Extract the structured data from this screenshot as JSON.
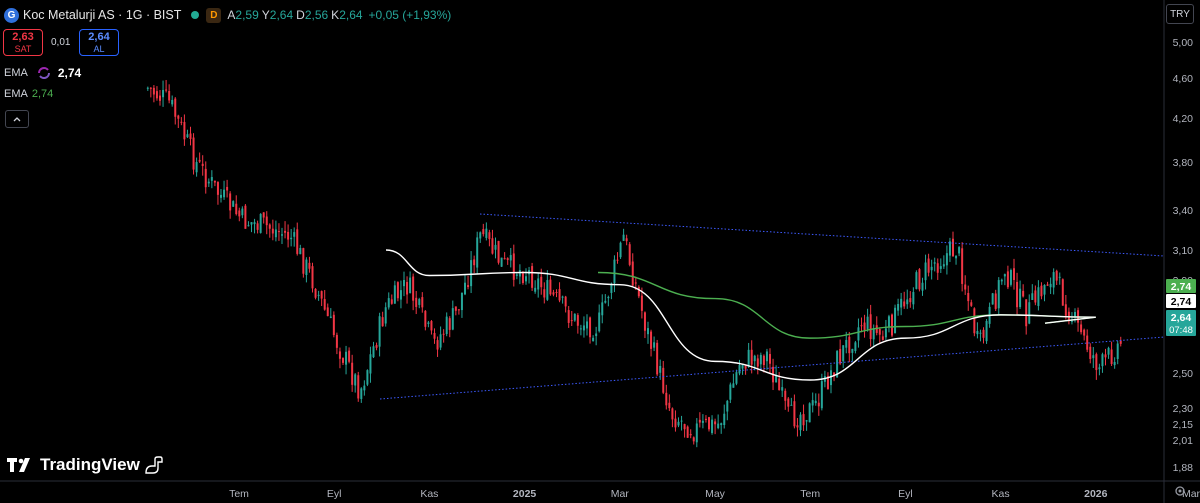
{
  "header": {
    "logo_letter": "G",
    "title": "Koc Metalurji AS · 1G · BIST",
    "badge": "D",
    "ohlc": [
      {
        "k": "A",
        "v": "2,59"
      },
      {
        "k": "Y",
        "v": "2,64"
      },
      {
        "k": "D",
        "v": "2,56"
      },
      {
        "k": "K",
        "v": "2,64"
      }
    ],
    "change": "+0,05 (+1,93%)"
  },
  "trade": {
    "sell_value": "2,63",
    "sell_label": "SAT",
    "spread": "0,01",
    "buy_value": "2,64",
    "buy_label": "AL"
  },
  "indicators": [
    {
      "name": "EMA",
      "value": "2,74",
      "color": "#ffffff"
    },
    {
      "name": "EMA",
      "value": "2,74",
      "color": "#4caf50"
    }
  ],
  "collapse_icon": "chevron-up-icon",
  "currency": "TRY",
  "logo_text": "TradingView",
  "colors": {
    "up": "#26a69a",
    "down": "#f23645",
    "ema_fast": "#ffffff",
    "ema_slow": "#4caf50",
    "trendline": "#3d5afe",
    "background": "#000000"
  },
  "chart_data": {
    "type": "candlestick",
    "y_ticks": [
      "5,00",
      "4,60",
      "4,20",
      "3,80",
      "3,40",
      "3,10",
      "2,90",
      "2,74",
      "2,64",
      "2,50",
      "2,30",
      "2,15",
      "2,01",
      "1,88"
    ],
    "x_ticks": [
      "Tem",
      "Eyl",
      "Kas",
      "2025",
      "Mar",
      "May",
      "Tem",
      "Eyl",
      "Kas",
      "2026",
      "Mar"
    ],
    "price_labels": [
      {
        "value": "2,74",
        "color": "#4caf50"
      },
      {
        "value": "2,74",
        "color": "#ffffff"
      },
      {
        "value": "2,64",
        "color": "#26a69a",
        "countdown": "07:48"
      }
    ],
    "trendlines": [
      {
        "from": [
          "Eyl 2024",
          3.38
        ],
        "to": [
          "Mar 2026",
          3.05
        ]
      },
      {
        "from": [
          "Eyl 2024",
          2.37
        ],
        "to": [
          "Mar 2026",
          2.55
        ]
      }
    ],
    "price_path": [
      [
        "May 2024",
        4.5
      ],
      [
        "May 2024",
        4.35
      ],
      [
        "Haz 2024",
        3.8
      ],
      [
        "Haz 2024",
        3.55
      ],
      [
        "Tem 2024",
        3.32
      ],
      [
        "Tem 2024",
        3.28
      ],
      [
        "Ağu 2024",
        3.2
      ],
      [
        "Ağu 2024",
        2.9
      ],
      [
        "Eyl 2024",
        2.62
      ],
      [
        "Eyl 2024",
        2.4
      ],
      [
        "Eki 2024",
        2.78
      ],
      [
        "Eki 2024",
        2.88
      ],
      [
        "Kas 2024",
        2.62
      ],
      [
        "Kas 2024",
        2.75
      ],
      [
        "Ara 2024",
        3.22
      ],
      [
        "Ara 2024",
        3.0
      ],
      [
        "Oca 2025",
        2.95
      ],
      [
        "Şub 2025",
        2.72
      ],
      [
        "Şub 2025",
        2.7
      ],
      [
        "Mar 2025",
        3.2
      ],
      [
        "Mar 2025",
        2.7
      ],
      [
        "Nis 2025",
        2.25
      ],
      [
        "Nis 2025",
        2.1
      ],
      [
        "May 2025",
        2.15
      ],
      [
        "May 2025",
        2.55
      ],
      [
        "Haz 2025",
        2.58
      ],
      [
        "Haz 2025",
        2.2
      ],
      [
        "Tem 2025",
        2.3
      ],
      [
        "Tem 2025",
        2.55
      ],
      [
        "Ağu 2025",
        2.72
      ],
      [
        "Ağu 2025",
        2.65
      ],
      [
        "Eyl 2025",
        2.85
      ],
      [
        "Eyl 2025",
        3.0
      ],
      [
        "Eki 2025",
        3.12
      ],
      [
        "Eki 2025",
        2.6
      ],
      [
        "Kas 2025",
        2.98
      ],
      [
        "Kas 2025",
        2.75
      ],
      [
        "Ara 2025",
        2.95
      ],
      [
        "Ara 2025",
        2.72
      ],
      [
        "Oca 2026",
        2.52
      ],
      [
        "Oca 2026",
        2.64
      ]
    ],
    "ema_fast": [
      [
        "Eyl 2024",
        3.1
      ],
      [
        "Kas 2024",
        2.93
      ],
      [
        "Oca 2025",
        2.95
      ],
      [
        "Mar 2025",
        2.88
      ],
      [
        "May 2025",
        2.55
      ],
      [
        "Tem 2025",
        2.46
      ],
      [
        "Eyl 2025",
        2.65
      ],
      [
        "Kas 2025",
        2.75
      ],
      [
        "Oca 2026",
        2.74
      ]
    ],
    "ema_slow": [
      [
        "Mar 2025",
        2.95
      ],
      [
        "May 2025",
        2.82
      ],
      [
        "Tem 2025",
        2.65
      ],
      [
        "Eyl 2025",
        2.7
      ],
      [
        "Kas 2025",
        2.75
      ],
      [
        "Oca 2026",
        2.74
      ]
    ]
  }
}
